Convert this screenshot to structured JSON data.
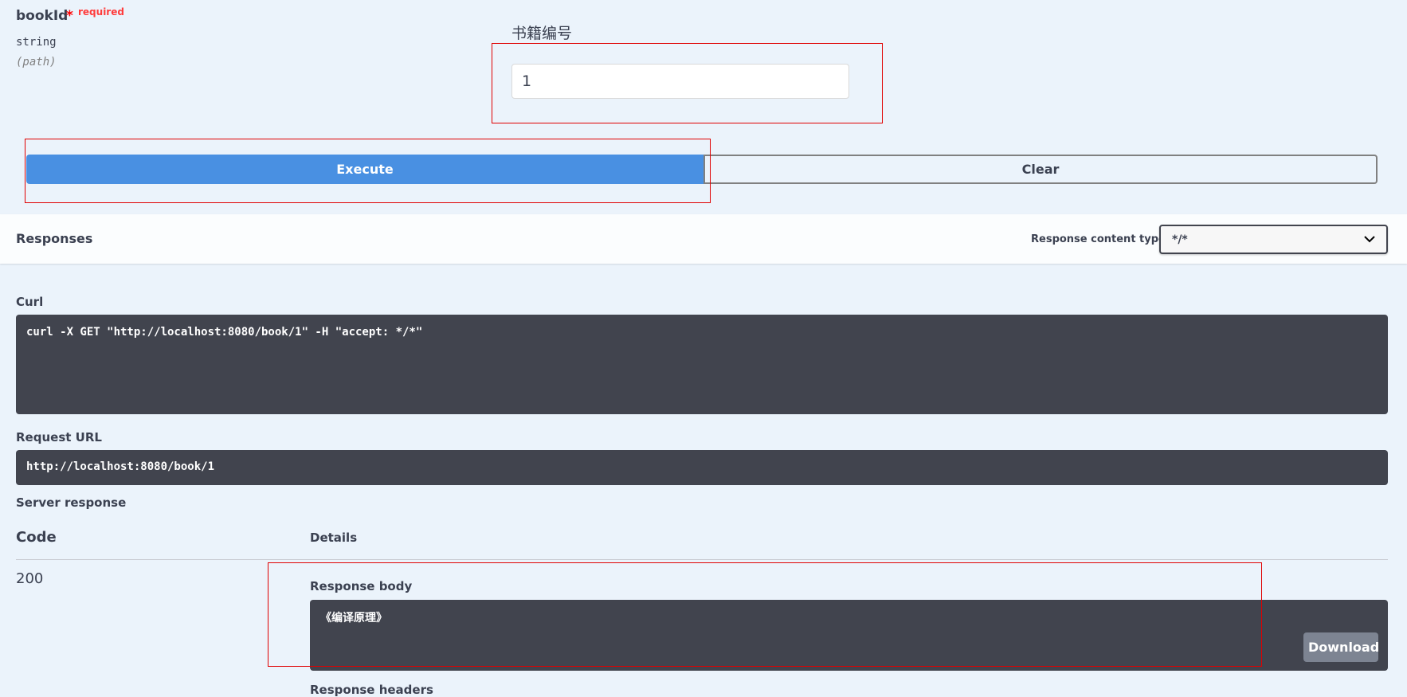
{
  "parameter": {
    "name": "bookId",
    "required_star": "*",
    "required_label": "required",
    "type": "string",
    "location": "(path)",
    "description": "书籍编号",
    "value": "1"
  },
  "actions": {
    "execute_label": "Execute",
    "clear_label": "Clear"
  },
  "responses": {
    "title": "Responses",
    "content_type_label": "Response content type",
    "content_type_value": "*/*"
  },
  "curl": {
    "label": "Curl",
    "command": "curl -X GET \"http://localhost:8080/book/1\" -H \"accept: */*\""
  },
  "request_url": {
    "label": "Request URL",
    "value": "http://localhost:8080/book/1"
  },
  "server_response": {
    "label": "Server response",
    "code_header": "Code",
    "details_header": "Details",
    "code": "200",
    "body_label": "Response body",
    "body": "《编译原理》",
    "download_label": "Download",
    "headers_label": "Response headers"
  },
  "colors": {
    "accent": "#4990e2",
    "highlight": "#e00000",
    "code_bg": "#41444e"
  }
}
